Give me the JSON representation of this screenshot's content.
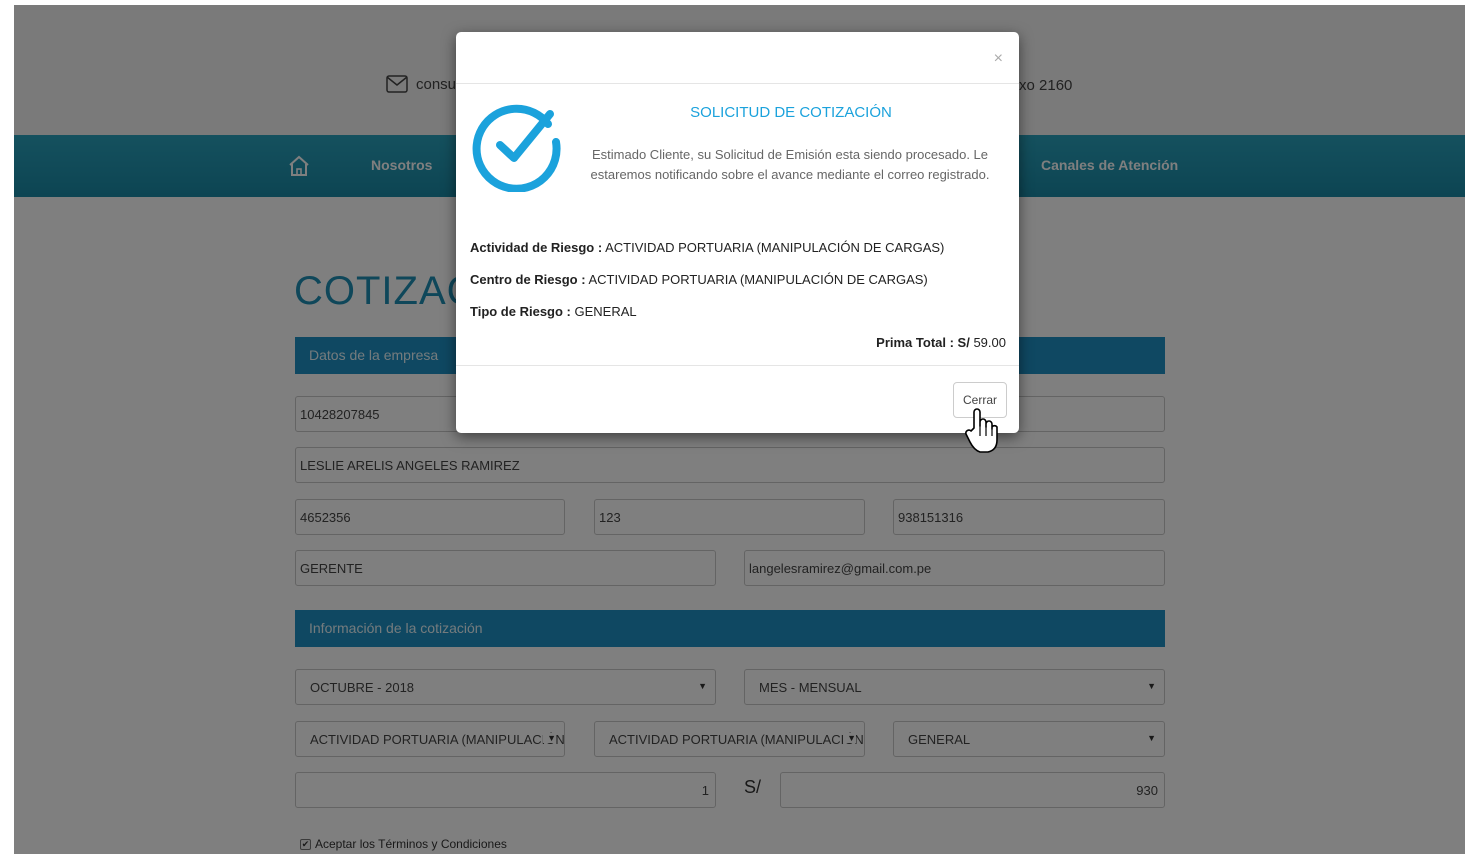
{
  "header": {
    "email_text": "consu",
    "phone_text": "xo 2160"
  },
  "nav": {
    "items": [
      {
        "label": "Nosotros"
      },
      {
        "label": "Canales de Atención"
      }
    ]
  },
  "page": {
    "title": "COTIZACI"
  },
  "form": {
    "section_empresa": "Datos de la empresa",
    "ruc": "10428207845",
    "razon_social": "LESLIE ARELIS ANGELES RAMIREZ",
    "telefono": "4652356",
    "anexo": "123",
    "celular": "938151316",
    "cargo": "GERENTE",
    "email": "langelesramirez@gmail.com.pe",
    "section_cotizacion": "Información de la cotización",
    "periodo": "OCTUBRE - 2018",
    "frecuencia": "MES - MENSUAL",
    "actividad": "ACTIVIDAD PORTUARIA (MANIPULACIÓN",
    "centro": "ACTIVIDAD PORTUARIA (MANIPULACIÓN",
    "tipo": "GENERAL",
    "cantidad": "1",
    "currency_symbol": "S/",
    "monto": "930",
    "terms_label": "Aceptar los Términos y Condiciones"
  },
  "modal": {
    "close_symbol": "×",
    "title": "SOLICITUD DE COTIZACIÓN",
    "message": "Estimado Cliente, su Solicitud de Emisión esta siendo procesado. Le estaremos notificando sobre el avance mediante el correo registrado.",
    "actividad_label": "Actividad de Riesgo :",
    "actividad_value": "ACTIVIDAD PORTUARIA (MANIPULACIÓN DE CARGAS)",
    "centro_label": "Centro de Riesgo :",
    "centro_value": "ACTIVIDAD PORTUARIA (MANIPULACIÓN DE CARGAS)",
    "tipo_label": "Tipo de Riesgo :",
    "tipo_value": "GENERAL",
    "prima_label": "Prima Total : S/",
    "prima_value": "59.00",
    "close_button": "Cerrar"
  },
  "colors": {
    "primary": "#1f90c4",
    "nav": "#1a8aa6",
    "check": "#1ba2dc"
  }
}
